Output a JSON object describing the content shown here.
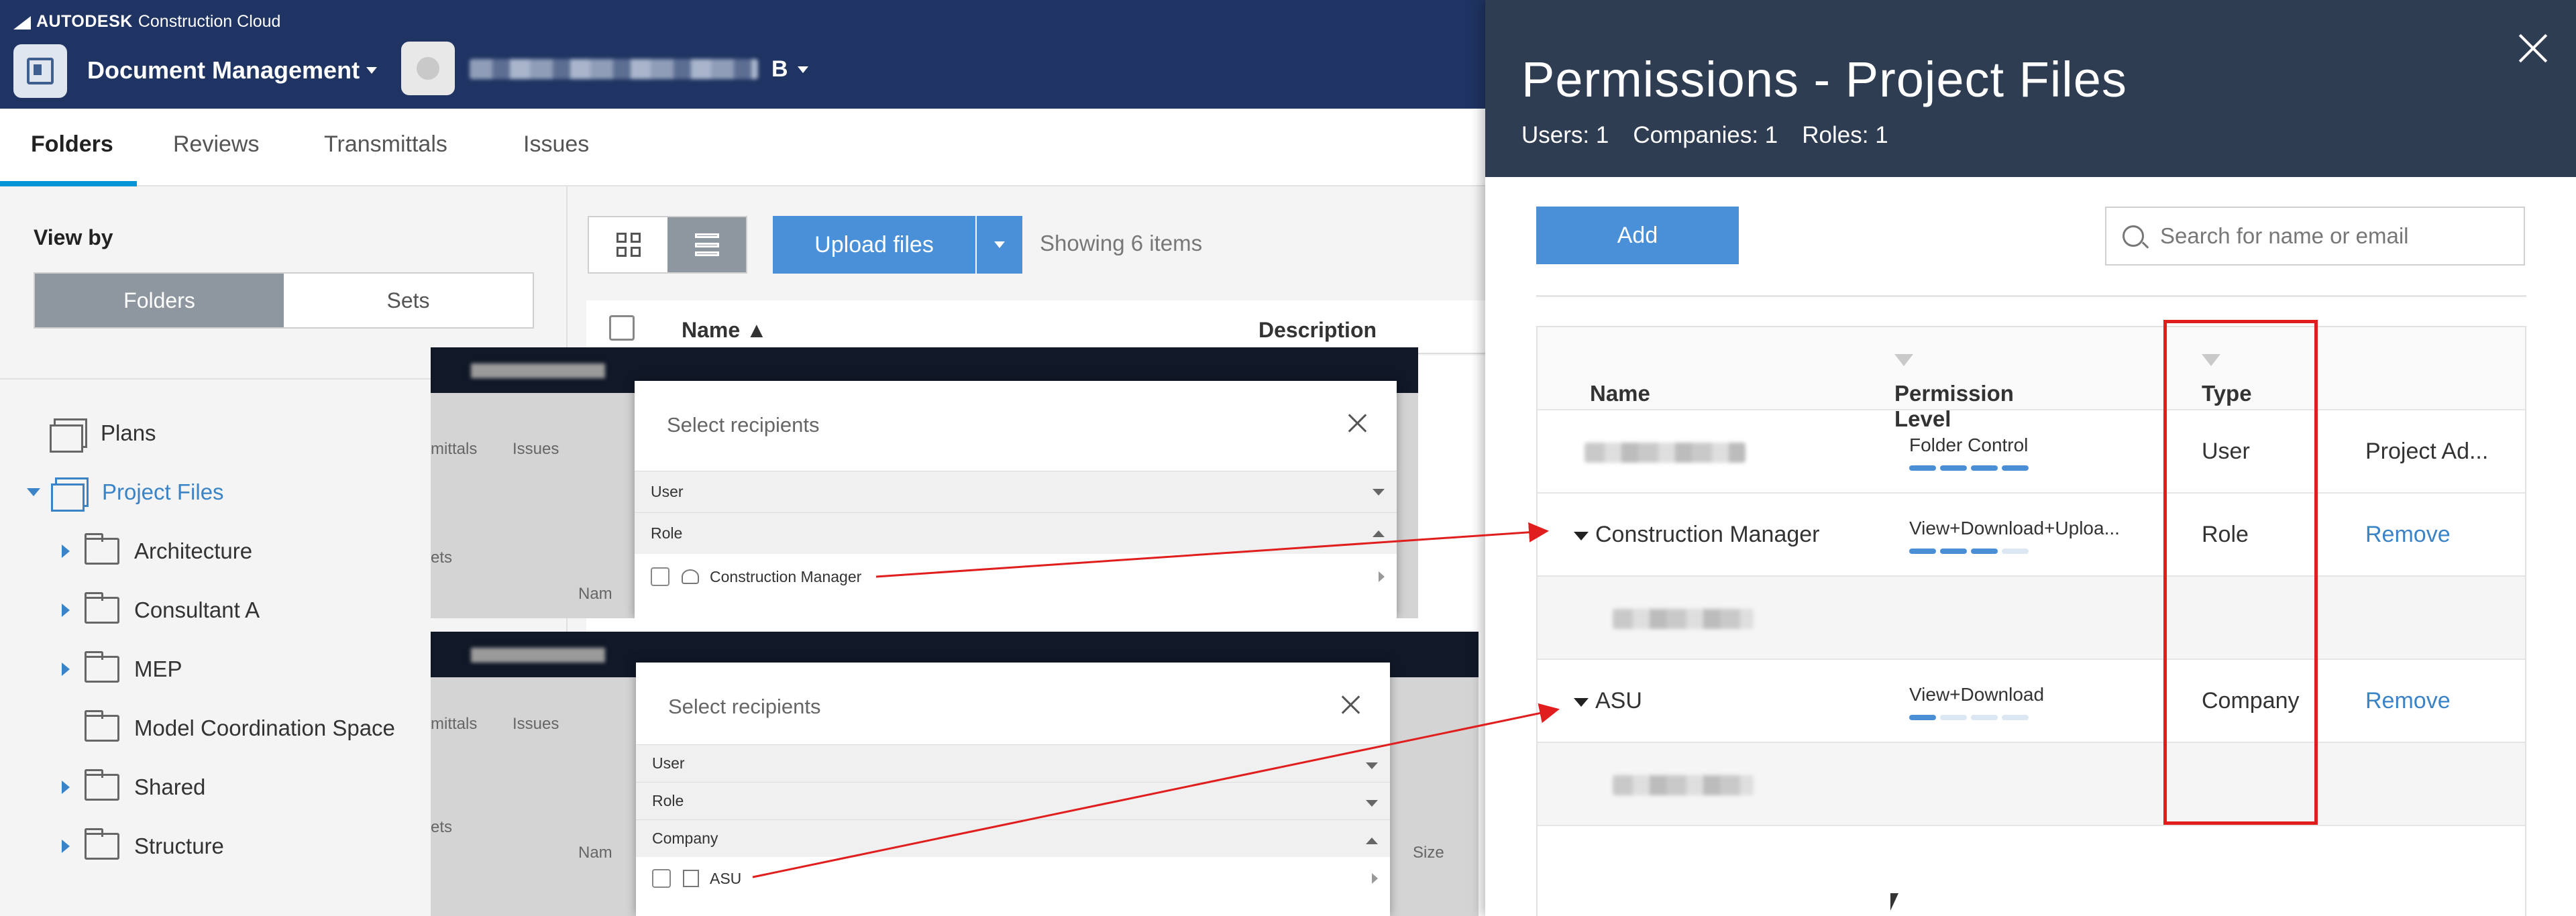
{
  "brand": {
    "bold": "AUTODESK",
    "rest": "Construction Cloud"
  },
  "header": {
    "module": "Document Management",
    "project_initial": "B"
  },
  "tabs": [
    "Folders",
    "Reviews",
    "Transmittals",
    "Issues"
  ],
  "sidebar": {
    "view_by": "View by",
    "seg_folders": "Folders",
    "seg_sets": "Sets",
    "tree": [
      {
        "label": "Plans"
      },
      {
        "label": "Project Files"
      },
      {
        "label": "Architecture"
      },
      {
        "label": "Consultant A"
      },
      {
        "label": "MEP"
      },
      {
        "label": "Model Coordination Space"
      },
      {
        "label": "Shared"
      },
      {
        "label": "Structure"
      }
    ]
  },
  "main": {
    "upload": "Upload files",
    "showing": "Showing 6 items",
    "col_name": "Name",
    "col_desc": "Description"
  },
  "inset1": {
    "bg_tab1": "mittals",
    "bg_tab2": "Issues",
    "bg_sets": "ets",
    "bg_name": "Nam",
    "title": "Select recipients",
    "sections": [
      "User",
      "Role"
    ],
    "option": "Construction Manager"
  },
  "inset2": {
    "bg_tab1": "mittals",
    "bg_tab2": "Issues",
    "bg_sets": "ets",
    "bg_name": "Nam",
    "bg_size": "Size",
    "title": "Select recipients",
    "sections": [
      "User",
      "Role",
      "Company"
    ],
    "option": "ASU"
  },
  "panel": {
    "title": "Permissions - Project Files",
    "counts": [
      "Users: 1",
      "Companies: 1",
      "Roles: 1"
    ],
    "add": "Add",
    "search_placeholder": "Search for name or email",
    "headers": {
      "name": "Name",
      "level": "Permission Level",
      "type": "Type"
    },
    "rows": [
      {
        "name": "",
        "level": "Folder Control",
        "level_fill": 4,
        "type": "User",
        "action": "Project Ad..."
      },
      {
        "name": "Construction Manager",
        "level": "View+Download+Uploa...",
        "level_fill": 3,
        "type": "Role",
        "action": "Remove"
      },
      {
        "name": "ASU",
        "level": "View+Download",
        "level_fill": 1,
        "type": "Company",
        "action": "Remove"
      }
    ]
  },
  "colors": {
    "header": "#1f3462",
    "panel_header": "#2f3d52",
    "accent": "#4a90d9",
    "highlight": "#e01e1e"
  }
}
